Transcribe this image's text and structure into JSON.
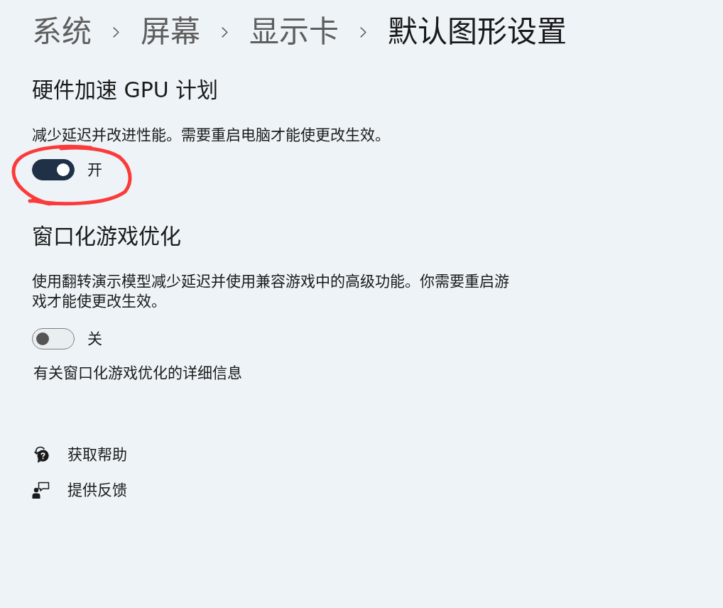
{
  "breadcrumb": [
    {
      "label": "系统",
      "current": false
    },
    {
      "label": "屏幕",
      "current": false
    },
    {
      "label": "显示卡",
      "current": false
    },
    {
      "label": "默认图形设置",
      "current": true
    }
  ],
  "sections": [
    {
      "title": "硬件加速 GPU 计划",
      "description": "减少延迟并改进性能。需要重启电脑才能使更改生效。",
      "toggle": {
        "on": true,
        "label": "开"
      },
      "annotated": true
    },
    {
      "title": "窗口化游戏优化",
      "description": "使用翻转演示模型减少延迟并使用兼容游戏中的高级功能。你需要重启游戏才能使更改生效。",
      "toggle": {
        "on": false,
        "label": "关"
      },
      "link": "有关窗口化游戏优化的详细信息",
      "annotated": false
    }
  ],
  "help_links": [
    {
      "kind": "help",
      "label": "获取帮助"
    },
    {
      "kind": "feedback",
      "label": "提供反馈"
    }
  ]
}
